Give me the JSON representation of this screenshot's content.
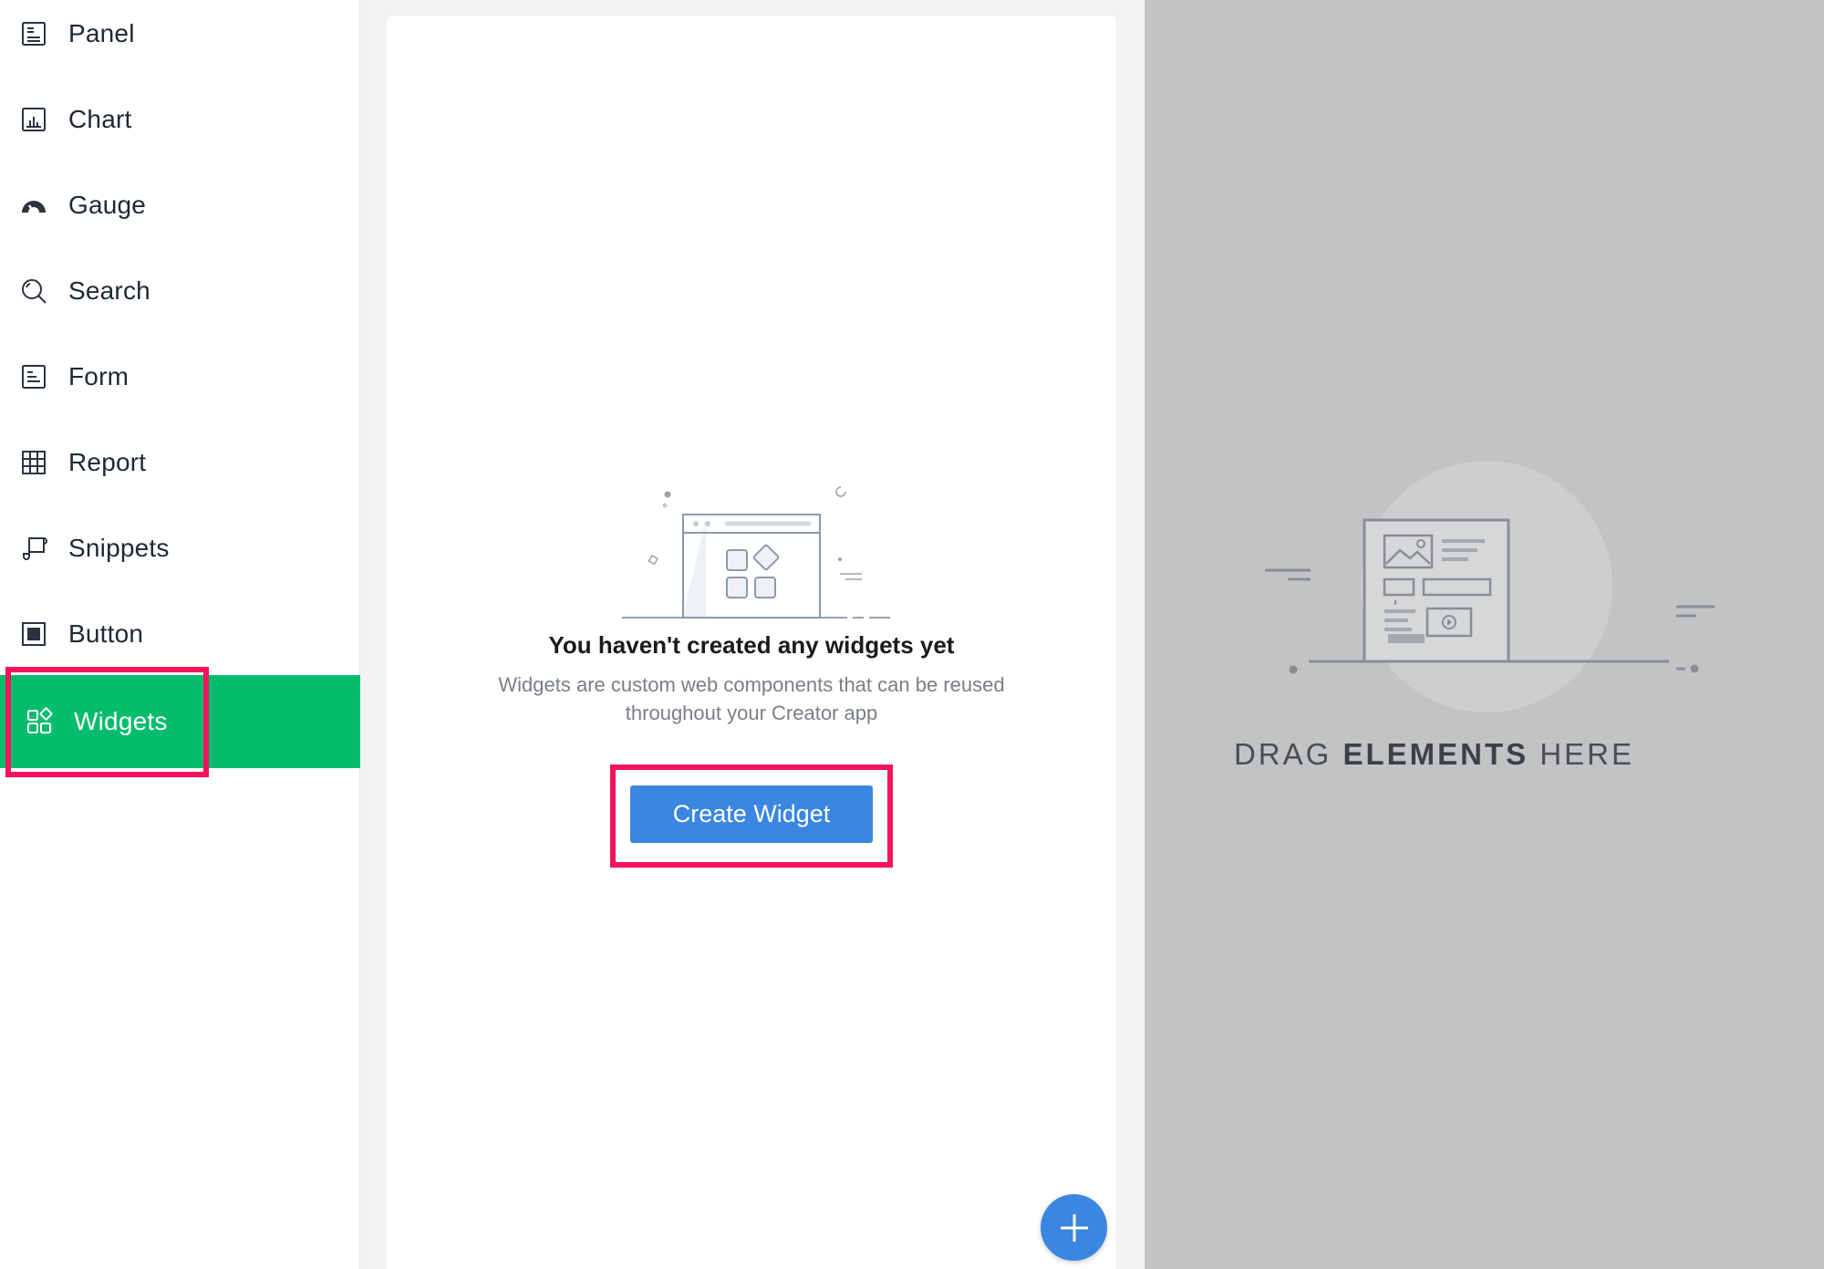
{
  "sidebar": {
    "items": [
      {
        "label": "Panel",
        "icon": "panel-icon"
      },
      {
        "label": "Chart",
        "icon": "chart-icon"
      },
      {
        "label": "Gauge",
        "icon": "gauge-icon"
      },
      {
        "label": "Search",
        "icon": "search-icon"
      },
      {
        "label": "Form",
        "icon": "form-icon"
      },
      {
        "label": "Report",
        "icon": "report-icon"
      },
      {
        "label": "Snippets",
        "icon": "snippets-icon"
      },
      {
        "label": "Button",
        "icon": "button-icon"
      },
      {
        "label": "Widgets",
        "icon": "widgets-icon",
        "active": true
      }
    ],
    "active_color": "#03bd6c"
  },
  "widgets_panel": {
    "empty_title": "You haven't created any widgets yet",
    "empty_desc": "Widgets are custom web components that can be reused throughout your Creator app",
    "create_label": "Create Widget",
    "button_color": "#3a86e0"
  },
  "dropzone": {
    "text_prefix": "DRAG ",
    "text_bold": "ELEMENTS",
    "text_suffix": " HERE",
    "background": "#c2c3c5"
  },
  "highlight_color": "#f5145c"
}
